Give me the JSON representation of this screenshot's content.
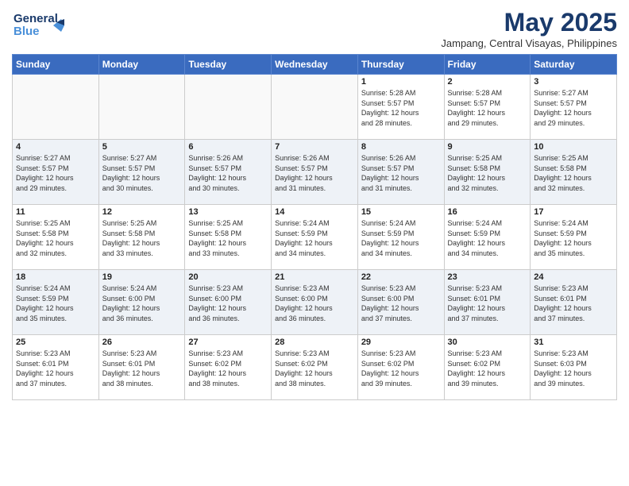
{
  "logo": {
    "line1": "General",
    "line2": "Blue"
  },
  "title": "May 2025",
  "location": "Jampang, Central Visayas, Philippines",
  "days_of_week": [
    "Sunday",
    "Monday",
    "Tuesday",
    "Wednesday",
    "Thursday",
    "Friday",
    "Saturday"
  ],
  "weeks": [
    [
      {
        "day": "",
        "info": ""
      },
      {
        "day": "",
        "info": ""
      },
      {
        "day": "",
        "info": ""
      },
      {
        "day": "",
        "info": ""
      },
      {
        "day": "1",
        "info": "Sunrise: 5:28 AM\nSunset: 5:57 PM\nDaylight: 12 hours\nand 28 minutes."
      },
      {
        "day": "2",
        "info": "Sunrise: 5:28 AM\nSunset: 5:57 PM\nDaylight: 12 hours\nand 29 minutes."
      },
      {
        "day": "3",
        "info": "Sunrise: 5:27 AM\nSunset: 5:57 PM\nDaylight: 12 hours\nand 29 minutes."
      }
    ],
    [
      {
        "day": "4",
        "info": "Sunrise: 5:27 AM\nSunset: 5:57 PM\nDaylight: 12 hours\nand 29 minutes."
      },
      {
        "day": "5",
        "info": "Sunrise: 5:27 AM\nSunset: 5:57 PM\nDaylight: 12 hours\nand 30 minutes."
      },
      {
        "day": "6",
        "info": "Sunrise: 5:26 AM\nSunset: 5:57 PM\nDaylight: 12 hours\nand 30 minutes."
      },
      {
        "day": "7",
        "info": "Sunrise: 5:26 AM\nSunset: 5:57 PM\nDaylight: 12 hours\nand 31 minutes."
      },
      {
        "day": "8",
        "info": "Sunrise: 5:26 AM\nSunset: 5:57 PM\nDaylight: 12 hours\nand 31 minutes."
      },
      {
        "day": "9",
        "info": "Sunrise: 5:25 AM\nSunset: 5:58 PM\nDaylight: 12 hours\nand 32 minutes."
      },
      {
        "day": "10",
        "info": "Sunrise: 5:25 AM\nSunset: 5:58 PM\nDaylight: 12 hours\nand 32 minutes."
      }
    ],
    [
      {
        "day": "11",
        "info": "Sunrise: 5:25 AM\nSunset: 5:58 PM\nDaylight: 12 hours\nand 32 minutes."
      },
      {
        "day": "12",
        "info": "Sunrise: 5:25 AM\nSunset: 5:58 PM\nDaylight: 12 hours\nand 33 minutes."
      },
      {
        "day": "13",
        "info": "Sunrise: 5:25 AM\nSunset: 5:58 PM\nDaylight: 12 hours\nand 33 minutes."
      },
      {
        "day": "14",
        "info": "Sunrise: 5:24 AM\nSunset: 5:59 PM\nDaylight: 12 hours\nand 34 minutes."
      },
      {
        "day": "15",
        "info": "Sunrise: 5:24 AM\nSunset: 5:59 PM\nDaylight: 12 hours\nand 34 minutes."
      },
      {
        "day": "16",
        "info": "Sunrise: 5:24 AM\nSunset: 5:59 PM\nDaylight: 12 hours\nand 34 minutes."
      },
      {
        "day": "17",
        "info": "Sunrise: 5:24 AM\nSunset: 5:59 PM\nDaylight: 12 hours\nand 35 minutes."
      }
    ],
    [
      {
        "day": "18",
        "info": "Sunrise: 5:24 AM\nSunset: 5:59 PM\nDaylight: 12 hours\nand 35 minutes."
      },
      {
        "day": "19",
        "info": "Sunrise: 5:24 AM\nSunset: 6:00 PM\nDaylight: 12 hours\nand 36 minutes."
      },
      {
        "day": "20",
        "info": "Sunrise: 5:23 AM\nSunset: 6:00 PM\nDaylight: 12 hours\nand 36 minutes."
      },
      {
        "day": "21",
        "info": "Sunrise: 5:23 AM\nSunset: 6:00 PM\nDaylight: 12 hours\nand 36 minutes."
      },
      {
        "day": "22",
        "info": "Sunrise: 5:23 AM\nSunset: 6:00 PM\nDaylight: 12 hours\nand 37 minutes."
      },
      {
        "day": "23",
        "info": "Sunrise: 5:23 AM\nSunset: 6:01 PM\nDaylight: 12 hours\nand 37 minutes."
      },
      {
        "day": "24",
        "info": "Sunrise: 5:23 AM\nSunset: 6:01 PM\nDaylight: 12 hours\nand 37 minutes."
      }
    ],
    [
      {
        "day": "25",
        "info": "Sunrise: 5:23 AM\nSunset: 6:01 PM\nDaylight: 12 hours\nand 37 minutes."
      },
      {
        "day": "26",
        "info": "Sunrise: 5:23 AM\nSunset: 6:01 PM\nDaylight: 12 hours\nand 38 minutes."
      },
      {
        "day": "27",
        "info": "Sunrise: 5:23 AM\nSunset: 6:02 PM\nDaylight: 12 hours\nand 38 minutes."
      },
      {
        "day": "28",
        "info": "Sunrise: 5:23 AM\nSunset: 6:02 PM\nDaylight: 12 hours\nand 38 minutes."
      },
      {
        "day": "29",
        "info": "Sunrise: 5:23 AM\nSunset: 6:02 PM\nDaylight: 12 hours\nand 39 minutes."
      },
      {
        "day": "30",
        "info": "Sunrise: 5:23 AM\nSunset: 6:02 PM\nDaylight: 12 hours\nand 39 minutes."
      },
      {
        "day": "31",
        "info": "Sunrise: 5:23 AM\nSunset: 6:03 PM\nDaylight: 12 hours\nand 39 minutes."
      }
    ]
  ]
}
